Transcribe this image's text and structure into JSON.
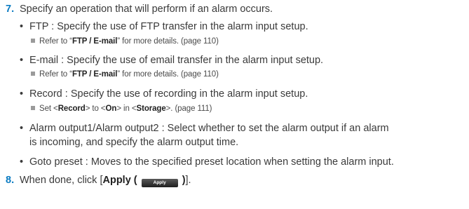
{
  "step7": {
    "number": "7.",
    "text": "Specify an operation that will perform if an alarm occurs."
  },
  "bullets": {
    "ftp": {
      "text": "FTP : Specify the use of FTP transfer in the alarm input setup.",
      "ref_pre": "Refer to “",
      "ref_bold": "FTP / E-mail",
      "ref_post": "” for more details. (page 110)"
    },
    "email": {
      "text": "E-mail : Specify the use of email transfer in the alarm input setup.",
      "ref_pre": "Refer to “",
      "ref_bold": "FTP / E-mail",
      "ref_post": "” for more details. (page 110)"
    },
    "record": {
      "text": "Record : Specify the use of recording in the alarm input setup.",
      "ref_p1": "Set <",
      "ref_b1": "Record",
      "ref_p2": "> to <",
      "ref_b2": "On",
      "ref_p3": "> in <",
      "ref_b3": "Storage",
      "ref_p4": ">. (page 111)"
    },
    "alarm_output": {
      "line1": "Alarm output1/Alarm output2 : Select whether to set the alarm output if an alarm",
      "line2": "is incoming, and specify the alarm output time."
    },
    "goto_preset": {
      "text": "Goto preset : Moves to the specified preset location when setting the alarm input."
    }
  },
  "step8": {
    "number": "8.",
    "pre": "When done, click [",
    "bold": "Apply (",
    "button_label": "Apply",
    "bold_close": ")",
    "post": "]."
  }
}
